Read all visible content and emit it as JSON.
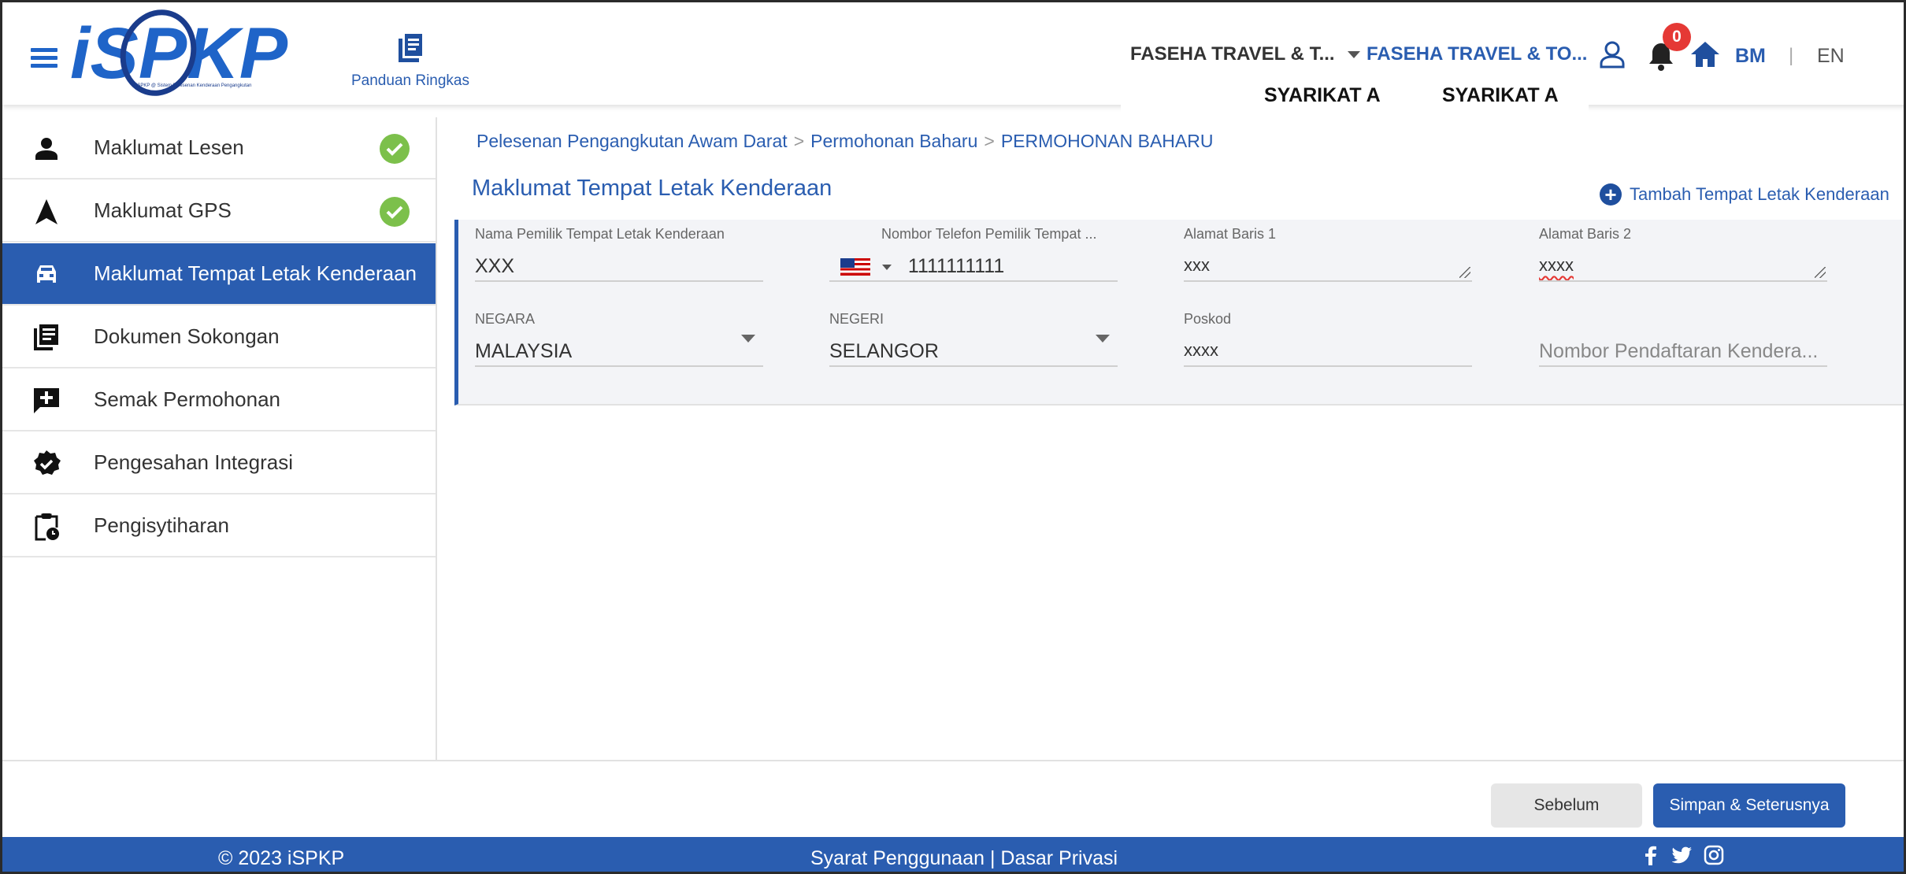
{
  "header": {
    "logo_text": "iSPKP",
    "logo_subtitle": "iSPKP @ Sistem Pelesenan Kenderaan Pengangkutan",
    "guide_label": "Panduan Ringkas",
    "company_select": "FASEHA TRAVEL & T...",
    "company_link": "FASEHA TRAVEL & TO...",
    "notification_count": "0",
    "lang_bm": "BM",
    "lang_sep": "|",
    "lang_en": "EN"
  },
  "tooltip": {
    "left": "SYARIKAT A",
    "right": "SYARIKAT A"
  },
  "sidebar": {
    "items": [
      {
        "label": "Maklumat Lesen",
        "icon": "person-icon",
        "completed": true
      },
      {
        "label": "Maklumat GPS",
        "icon": "navigation-arrow-icon",
        "completed": true
      },
      {
        "label": "Maklumat Tempat Letak Kenderaan",
        "icon": "car-icon",
        "active": true
      },
      {
        "label": "Dokumen Sokongan",
        "icon": "document-list-icon"
      },
      {
        "label": "Semak Permohonan",
        "icon": "add-comment-icon"
      },
      {
        "label": "Pengesahan Integrasi",
        "icon": "verified-badge-icon"
      },
      {
        "label": "Pengisytiharan",
        "icon": "clipboard-clock-icon"
      }
    ]
  },
  "breadcrumb": {
    "items": [
      "Pelesenan Pengangkutan Awam Darat",
      "Permohonan Baharu",
      "PERMOHONAN BAHARU"
    ],
    "separator": ">"
  },
  "section": {
    "title": "Maklumat Tempat Letak Kenderaan",
    "add_label": "Tambah Tempat Letak Kenderaan"
  },
  "form": {
    "owner_name": {
      "label": "Nama Pemilik Tempat Letak Kenderaan",
      "value": "XXX"
    },
    "owner_phone": {
      "label": "Nombor Telefon Pemilik Tempat ...",
      "value": "1111111111",
      "country": "MY"
    },
    "address1": {
      "label": "Alamat Baris 1",
      "value": "xxx"
    },
    "address2": {
      "label": "Alamat Baris 2",
      "value": "xxxx"
    },
    "country": {
      "label": "NEGARA",
      "value": "MALAYSIA"
    },
    "state": {
      "label": "NEGERI",
      "value": "SELANGOR"
    },
    "postcode": {
      "label": "Poskod",
      "value": "xxxx"
    },
    "vehicle_reg": {
      "placeholder": "Nombor Pendaftaran Kendera..."
    }
  },
  "actions": {
    "prev_label": "Sebelum",
    "next_label": "Simpan & Seterusnya"
  },
  "footer": {
    "copyright": "© 2023 iSPKP",
    "terms": "Syarat Penggunaan",
    "link_sep": " | ",
    "privacy": "Dasar Privasi"
  },
  "colors": {
    "primary": "#2a5db0",
    "success": "#7cc04b",
    "badge": "#e53935"
  }
}
